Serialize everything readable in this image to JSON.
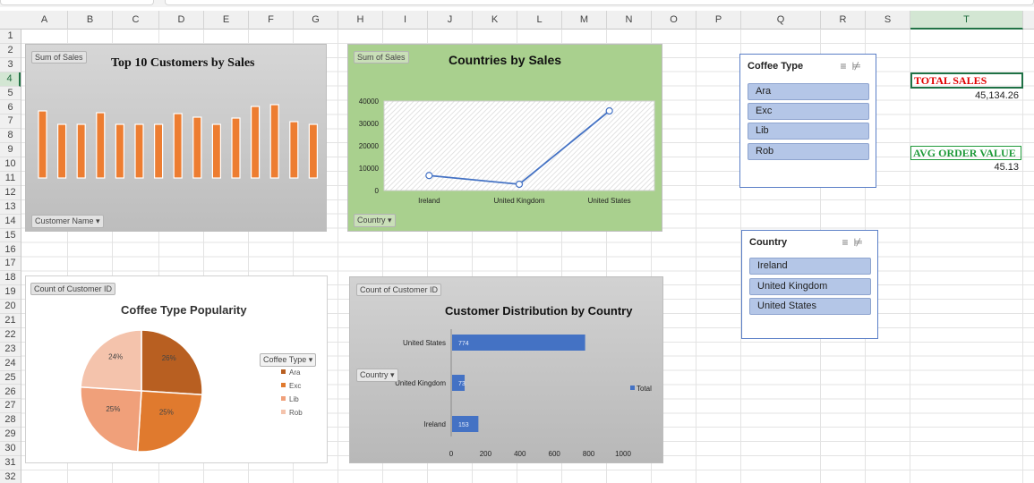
{
  "sheet": {
    "columns": [
      "A",
      "B",
      "C",
      "D",
      "E",
      "F",
      "G",
      "H",
      "I",
      "J",
      "K",
      "L",
      "M",
      "N",
      "O",
      "P",
      "Q",
      "R",
      "S",
      "T"
    ],
    "rows": [
      "1",
      "2",
      "3",
      "4",
      "5",
      "6",
      "7",
      "8",
      "9",
      "10",
      "11",
      "12",
      "13",
      "14",
      "15",
      "16",
      "17",
      "18",
      "19",
      "20",
      "21",
      "22",
      "23",
      "24",
      "25",
      "26",
      "27",
      "28",
      "29",
      "30",
      "31",
      "32"
    ],
    "selected_column": "T",
    "selected_row": "4"
  },
  "kpis": {
    "total_sales_label": "TOTAL SALES",
    "total_sales_value": "45,134.26",
    "avg_order_label": "AVG ORDER VALUE",
    "avg_order_value": "45.13",
    "colors": {
      "total": "#e00000",
      "avg": "#1f9a3a",
      "border": "#1e7145"
    }
  },
  "top10": {
    "field_button": "Sum of Sales",
    "axis_button": "Customer Name",
    "chart_data": {
      "type": "bar",
      "title": "Top 10 Customers by Sales",
      "values": [
        0.75,
        0.6,
        0.6,
        0.73,
        0.6,
        0.6,
        0.6,
        0.72,
        0.68,
        0.6,
        0.67,
        0.8,
        0.82,
        0.63,
        0.6
      ],
      "bar_color": "#ed7d31"
    }
  },
  "countries": {
    "field_button": "Sum of Sales",
    "axis_button": "Country",
    "chart_data": {
      "type": "line",
      "title": "Countries by Sales",
      "categories": [
        "Ireland",
        "United Kingdom",
        "United States"
      ],
      "values": [
        6700,
        2800,
        35600
      ],
      "yticks": [
        "0",
        "10000",
        "20000",
        "30000",
        "40000"
      ],
      "ylim": [
        0,
        40000
      ],
      "line_color": "#4472c4",
      "background": "#a9d08e"
    }
  },
  "pie": {
    "field_button": "Count of Customer ID",
    "legend_button": "Coffee Type",
    "chart_data": {
      "type": "pie",
      "title": "Coffee Type Popularity",
      "series": [
        {
          "name": "Ara",
          "value": 26,
          "label": "26%",
          "color": "#b85f21"
        },
        {
          "name": "Exc",
          "value": 25,
          "label": "25%",
          "color": "#e07a2e"
        },
        {
          "name": "Lib",
          "value": 25,
          "label": "25%",
          "color": "#f0a07a"
        },
        {
          "name": "Rob",
          "value": 24,
          "label": "24%",
          "color": "#f4c3ac"
        }
      ]
    }
  },
  "distribution": {
    "field_button": "Count of Customer ID",
    "axis_button": "Country",
    "chart_data": {
      "type": "bar",
      "orientation": "horizontal",
      "title": "Customer Distribution by Country",
      "categories": [
        "United States",
        "United Kingdom",
        "Ireland"
      ],
      "values": [
        774,
        73,
        153
      ],
      "xticks": [
        "0",
        "200",
        "400",
        "600",
        "800",
        "1000"
      ],
      "xlim": [
        0,
        1000
      ],
      "legend": "Total",
      "bar_color": "#4472c4"
    }
  },
  "slicers": {
    "coffee": {
      "title": "Coffee Type",
      "items": [
        "Ara",
        "Exc",
        "Lib",
        "Rob"
      ]
    },
    "country": {
      "title": "Country",
      "items": [
        "Ireland",
        "United Kingdom",
        "United States"
      ]
    }
  }
}
